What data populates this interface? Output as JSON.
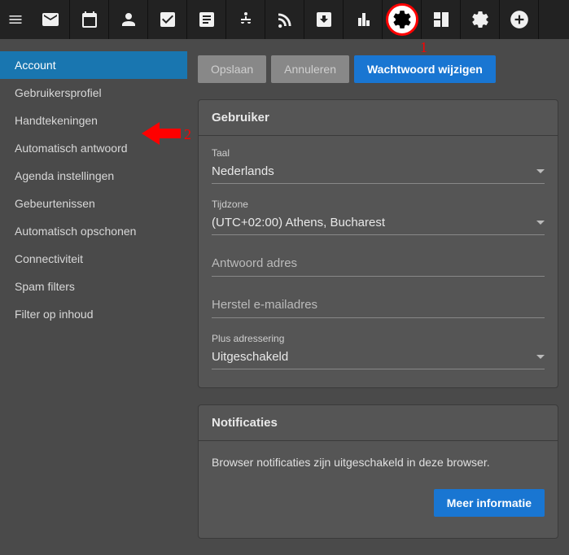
{
  "sidebar": {
    "items": [
      {
        "label": "Account",
        "active": true
      },
      {
        "label": "Gebruikersprofiel"
      },
      {
        "label": "Handtekeningen"
      },
      {
        "label": "Automatisch antwoord"
      },
      {
        "label": "Agenda instellingen"
      },
      {
        "label": "Gebeurtenissen"
      },
      {
        "label": "Automatisch opschonen"
      },
      {
        "label": "Connectiviteit"
      },
      {
        "label": "Spam filters"
      },
      {
        "label": "Filter op inhoud"
      }
    ]
  },
  "actions": {
    "save": "Opslaan",
    "cancel": "Annuleren",
    "change_password": "Wachtwoord wijzigen"
  },
  "panels": {
    "user": {
      "title": "Gebruiker",
      "language": {
        "label": "Taal",
        "value": "Nederlands"
      },
      "timezone": {
        "label": "Tijdzone",
        "value": "(UTC+02:00) Athens, Bucharest"
      },
      "reply_address": {
        "placeholder": "Antwoord adres"
      },
      "recovery_email": {
        "placeholder": "Herstel e-mailadres"
      },
      "plus_addressing": {
        "label": "Plus adressering",
        "value": "Uitgeschakeld"
      }
    },
    "notifications": {
      "title": "Notificaties",
      "message": "Browser notificaties zijn uitgeschakeld in deze browser.",
      "more_info": "Meer informatie"
    }
  },
  "annotations": {
    "one": "1",
    "two": "2"
  }
}
